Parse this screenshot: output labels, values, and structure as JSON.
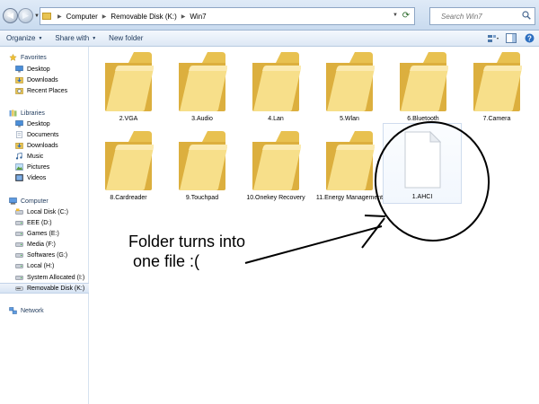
{
  "address_bar": {
    "breadcrumbs": [
      "Computer",
      "Removable Disk (K:)",
      "Win7"
    ],
    "search_placeholder": "Search Win7"
  },
  "toolbar": {
    "organize_label": "Organize",
    "share_label": "Share with",
    "new_folder_label": "New folder"
  },
  "sidebar": {
    "favorites": {
      "label": "Favorites",
      "items": [
        "Desktop",
        "Downloads",
        "Recent Places"
      ]
    },
    "libraries": {
      "label": "Libraries",
      "items": [
        "Desktop",
        "Documents",
        "Downloads",
        "Music",
        "Pictures",
        "Videos"
      ]
    },
    "computer": {
      "label": "Computer",
      "items": [
        "Local Disk (C:)",
        "EEE (D:)",
        "Games (E:)",
        "Media (F:)",
        "Softwares (G:)",
        "Local (H:)",
        "System Allocated (I:)",
        "Removable Disk (K:)"
      ],
      "selected": "Removable Disk (K:)"
    },
    "network": {
      "label": "Network"
    }
  },
  "content": {
    "folders": [
      "2.VGA",
      "3.Audio",
      "4.Lan",
      "5.Wlan",
      "6.Bluetooth",
      "7.Camera",
      "8.Cardreader",
      "9.Touchpad",
      "10.Onekey Recovery",
      "11.Energy Management"
    ],
    "file": "1.AHCI"
  },
  "annotation": {
    "text": "Folder turns into\n one file :(",
    "color": "#000000"
  },
  "colors": {
    "folder_light": "#f8e6a0",
    "folder_dark": "#e0b94a",
    "selection_blue": "#d7e4f4"
  }
}
